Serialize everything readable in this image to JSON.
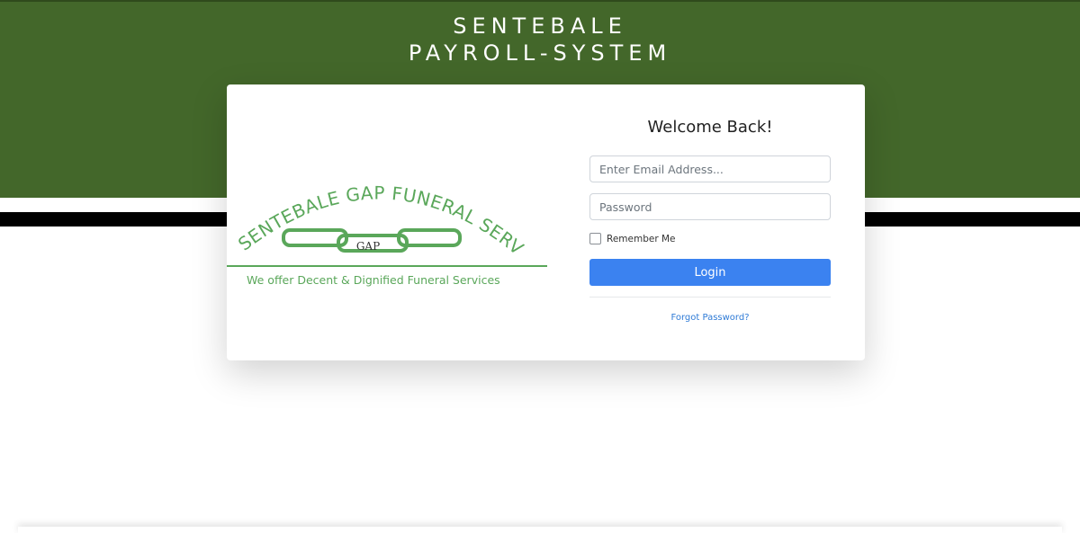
{
  "header": {
    "title_line1": "SENTEBALE",
    "title_line2": "PAYROLL-SYSTEM"
  },
  "logo": {
    "arc_text": "SENTEBALE GAP FUNERAL SERVICES",
    "chain_text": "GAP",
    "tagline": "We offer Decent & Dignified Funeral Services"
  },
  "login": {
    "welcome": "Welcome Back!",
    "email_placeholder": "Enter Email Address...",
    "password_placeholder": "Password",
    "remember_label": "Remember Me",
    "remember_checked": false,
    "button_label": "Login",
    "forgot_label": "Forgot Password?"
  },
  "colors": {
    "header_green": "#43672a",
    "logo_green": "#5aa75a",
    "button_blue": "#3b82f0",
    "link_blue": "#2f7bd6"
  }
}
